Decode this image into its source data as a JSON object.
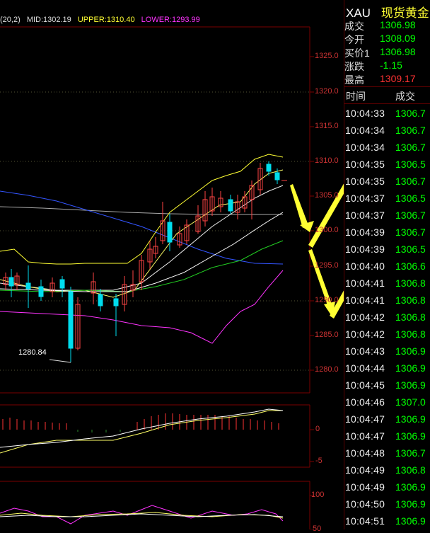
{
  "indicator": {
    "name": "(20,2)",
    "mid": "MID:1302.19",
    "upper": "UPPER:1310.40",
    "lower": "LOWER:1293.99",
    "colors": {
      "mid": "#dddddd",
      "upper": "#ffff33",
      "lower": "#ff33ff"
    }
  },
  "annotation_low": "1280.84",
  "price_axis": [
    "1325.0",
    "1320.0",
    "1315.0",
    "1310.0",
    "1305.0",
    "1300.0",
    "1295.0",
    "1290.0",
    "1285.0",
    "1280.0"
  ],
  "macd_axis": [
    "0",
    "-5"
  ],
  "kdj_axis": [
    "100",
    "50"
  ],
  "quote": {
    "symbol": "XAU",
    "name": "现货黄金",
    "rows": [
      {
        "label": "成交",
        "value": "1306.98",
        "color": "#00ff00"
      },
      {
        "label": "今开",
        "value": "1308.09",
        "color": "#00ff00"
      },
      {
        "label": "买价1",
        "value": "1306.98",
        "color": "#00ff00"
      },
      {
        "label": "涨跌",
        "value": "-1.15",
        "color": "#00ff00"
      },
      {
        "label": "最高",
        "value": "1309.17",
        "color": "#ff3333"
      }
    ]
  },
  "ticks_header": {
    "time": "时间",
    "price": "成交"
  },
  "ticks": [
    {
      "time": "10:04:33",
      "price": "1306.7"
    },
    {
      "time": "10:04:34",
      "price": "1306.7"
    },
    {
      "time": "10:04:34",
      "price": "1306.7"
    },
    {
      "time": "10:04:35",
      "price": "1306.5"
    },
    {
      "time": "10:04:35",
      "price": "1306.7"
    },
    {
      "time": "10:04:37",
      "price": "1306.5"
    },
    {
      "time": "10:04:37",
      "price": "1306.7"
    },
    {
      "time": "10:04:39",
      "price": "1306.7"
    },
    {
      "time": "10:04:39",
      "price": "1306.5"
    },
    {
      "time": "10:04:40",
      "price": "1306.6"
    },
    {
      "time": "10:04:41",
      "price": "1306.8"
    },
    {
      "time": "10:04:41",
      "price": "1306.8"
    },
    {
      "time": "10:04:42",
      "price": "1306.8"
    },
    {
      "time": "10:04:42",
      "price": "1306.8"
    },
    {
      "time": "10:04:43",
      "price": "1306.9"
    },
    {
      "time": "10:04:44",
      "price": "1306.9"
    },
    {
      "time": "10:04:45",
      "price": "1306.9"
    },
    {
      "time": "10:04:46",
      "price": "1307.0"
    },
    {
      "time": "10:04:47",
      "price": "1306.9"
    },
    {
      "time": "10:04:47",
      "price": "1306.9"
    },
    {
      "time": "10:04:48",
      "price": "1306.7"
    },
    {
      "time": "10:04:49",
      "price": "1306.8"
    },
    {
      "time": "10:04:49",
      "price": "1306.9"
    },
    {
      "time": "10:04:50",
      "price": "1306.9"
    },
    {
      "time": "10:04:51",
      "price": "1306.9"
    }
  ]
}
